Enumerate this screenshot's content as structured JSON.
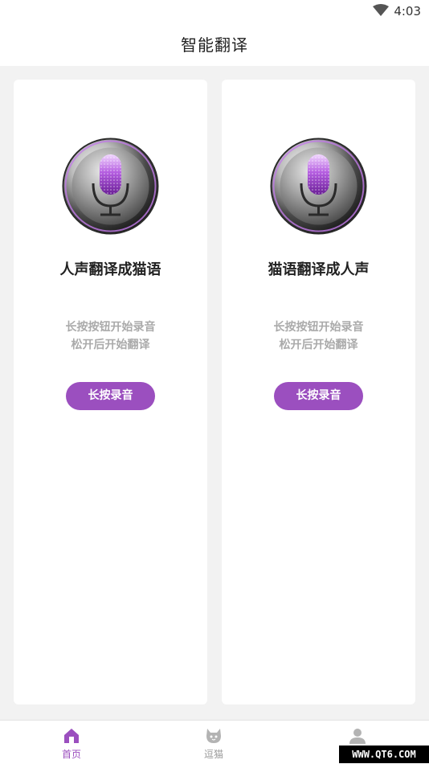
{
  "status_bar": {
    "time": "4:03",
    "icons": [
      "wifi-icon"
    ]
  },
  "header": {
    "title": "智能翻译"
  },
  "cards": [
    {
      "title": "人声翻译成猫语",
      "hint_line1": "长按按钮开始录音",
      "hint_line2": "松开后开始翻译",
      "button_label": "长按录音",
      "icon": "microphone-icon"
    },
    {
      "title": "猫语翻译成人声",
      "hint_line1": "长按按钮开始录音",
      "hint_line2": "松开后开始翻译",
      "button_label": "长按录音",
      "icon": "microphone-icon"
    }
  ],
  "tabbar": {
    "items": [
      {
        "label": "首页",
        "icon": "home-icon",
        "active": true
      },
      {
        "label": "逗猫",
        "icon": "cat-face-icon",
        "active": false
      },
      {
        "label": "",
        "icon": "user-icon",
        "active": false
      }
    ]
  },
  "watermark": {
    "text": "WWW.QT6.COM"
  },
  "colors": {
    "accent": "#9b4fbf",
    "background": "#f2f2f2",
    "card": "#ffffff",
    "hint_text": "#aaaaaa",
    "inactive_tab": "#999999"
  }
}
